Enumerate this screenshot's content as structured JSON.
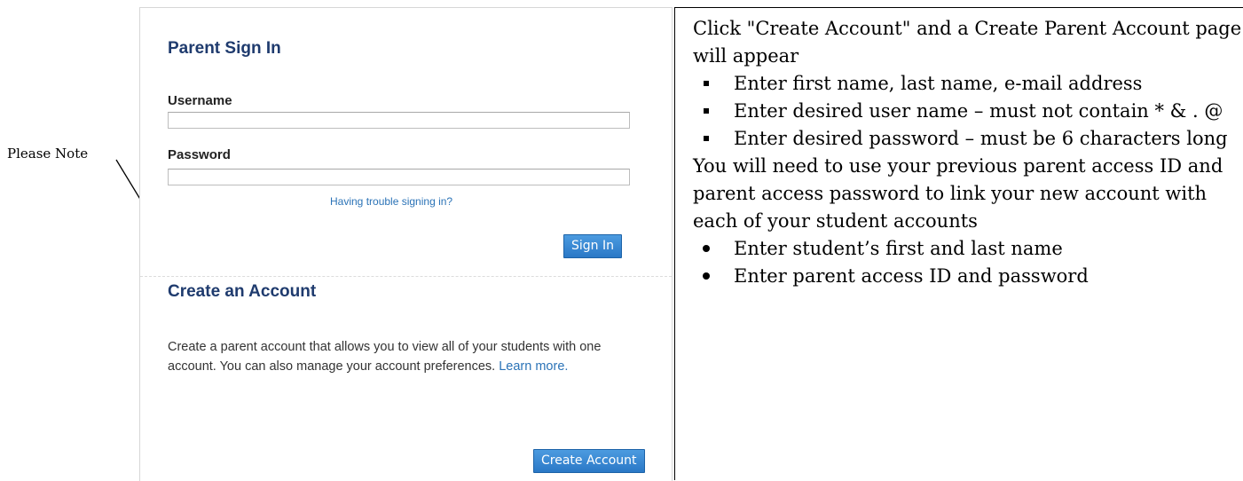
{
  "annotation": {
    "label": "Please Note"
  },
  "sign_in": {
    "title": "Parent Sign In",
    "username_label": "Username",
    "username_value": "",
    "password_label": "Password",
    "password_value": "",
    "trouble_link": "Having trouble signing in?",
    "sign_in_button": "Sign In"
  },
  "create_account": {
    "title": "Create an Account",
    "description": "Create a parent account that allows you to view all of your students with one account. You can also manage your account preferences.",
    "learn_more": "Learn more.",
    "button": "Create Account"
  },
  "instructions": {
    "intro": "Click \"Create Account\" and a Create Parent Account  page will appear",
    "steps_1": [
      "Enter first name, last name, e-mail address",
      "Enter desired user name – must not contain * & . @",
      "Enter desired password – must be 6 characters long"
    ],
    "middle": "You will need to use your previous parent access ID and parent access password to link your new account with each of your student accounts",
    "steps_2": [
      "Enter student’s first and last name",
      "Enter parent access ID and password"
    ]
  }
}
